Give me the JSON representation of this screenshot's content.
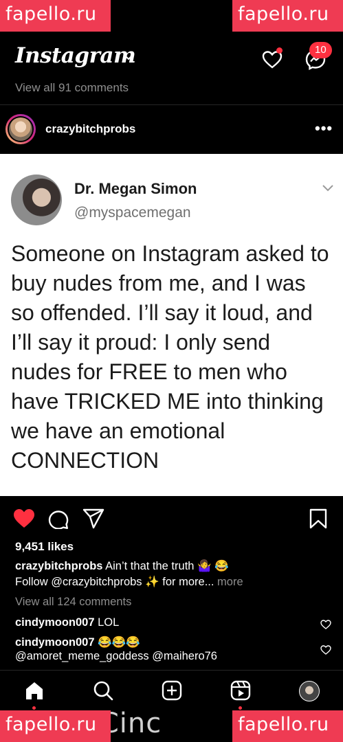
{
  "watermark": {
    "text": "fapello.ru"
  },
  "header": {
    "logo": "Instagram",
    "badge_count": "10",
    "icons": [
      "chevron-down-icon",
      "heart-icon",
      "messenger-icon"
    ]
  },
  "previous_post": {
    "view_all": "View all 91 comments"
  },
  "post": {
    "username": "crazybitchprobs",
    "tweet": {
      "name": "Dr. Megan Simon",
      "handle": "@myspacemegan",
      "text": "Someone on Instagram asked to buy nudes from me, and I was so offended. I’ll say it loud, and I’ll say it proud: I only send nudes for FREE to men who have TRICKED ME into thinking we have an emotional CONNECTION"
    },
    "likes": "9,451 likes",
    "caption_user": "crazybitchprobs",
    "caption_text": " Ain’t that the truth 🤷‍♀️ 😂",
    "caption_line2": "Follow @crazybitchprobs ✨ for more...",
    "caption_more": " more",
    "view_all": "View all 124 comments",
    "comments": [
      {
        "user": "cindymoon007",
        "text": " LOL"
      },
      {
        "user": "cindymoon007",
        "text": " 😂😂😂"
      }
    ],
    "comment_line3": "@amoret_meme_goddess @maihero76"
  },
  "nav": {
    "items": [
      "home-icon",
      "search-icon",
      "create-icon",
      "reels-icon",
      "profile-avatar"
    ]
  },
  "bottom_text": ".c m/Cinc"
}
